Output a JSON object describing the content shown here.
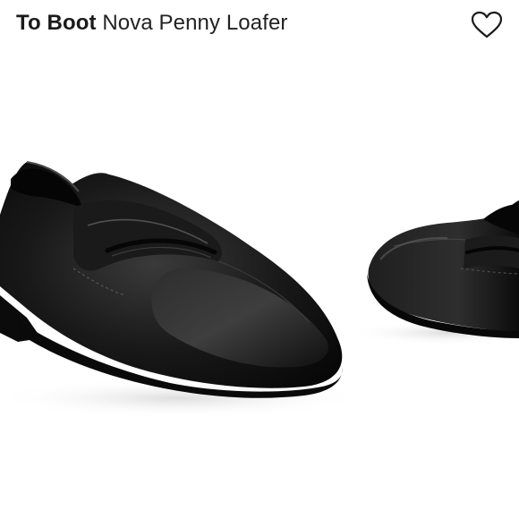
{
  "product": {
    "brand": "To Boot",
    "name": "Nova Penny Loafer"
  },
  "icons": {
    "wishlist": "heart-outline-icon"
  },
  "colors": {
    "title_text": "#222222",
    "shoe_leather": "#141414"
  }
}
